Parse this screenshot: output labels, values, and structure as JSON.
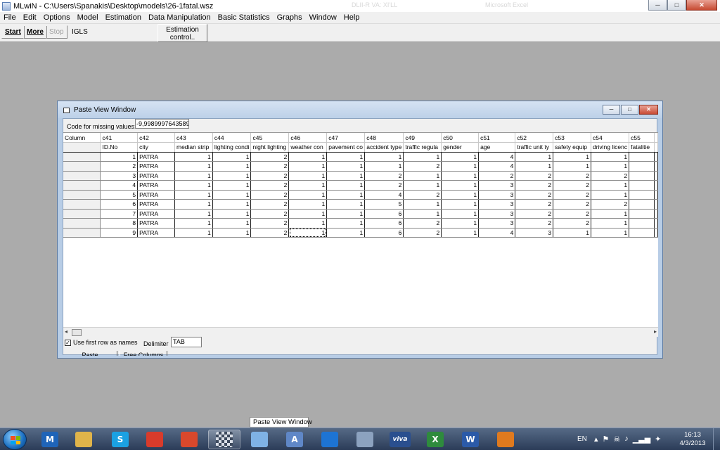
{
  "app": {
    "title": "MLwiN - C:\\Users\\Spanakis\\Desktop\\models\\26-1fatal.wsz",
    "ghost_title_1": "DLII-R VA: XI'LL",
    "ghost_title_2": "Microsoft Excel",
    "controls": {
      "minimize": "─",
      "maximize": "□",
      "close": "✕"
    }
  },
  "menu": [
    "File",
    "Edit",
    "Options",
    "Model",
    "Estimation",
    "Data Manipulation",
    "Basic Statistics",
    "Graphs",
    "Window",
    "Help"
  ],
  "toolbar": {
    "start": "Start",
    "more": "More",
    "stop": "Stop",
    "method": "IGLS",
    "estimation_control_line1": "Estimation",
    "estimation_control_line2": "control.."
  },
  "paste_view": {
    "title": "Paste View Window",
    "controls": {
      "minimize": "─",
      "maximize": "□",
      "close": "✕"
    },
    "missing_label": "Code for missing values:",
    "missing_value": "-9,9989997643589",
    "column_header": "Column",
    "columns": [
      "c41",
      "c42",
      "c43",
      "c44",
      "c45",
      "c46",
      "c47",
      "c48",
      "c49",
      "c50",
      "c51",
      "c52",
      "c53",
      "c54",
      "c55"
    ],
    "names": [
      "ID.No",
      "city",
      "median strip",
      "lighting condi",
      "night lighting",
      "weather con",
      "pavement co",
      "accident type",
      "traffic regula",
      "gender",
      "age",
      "traffic unit ty",
      "safety equip",
      "driving licenc",
      "fatalitie"
    ],
    "rows": [
      [
        "1",
        "PATRA",
        "1",
        "1",
        "2",
        "1",
        "1",
        "1",
        "1",
        "1",
        "4",
        "1",
        "1",
        "1",
        ""
      ],
      [
        "2",
        "PATRA",
        "1",
        "1",
        "2",
        "1",
        "1",
        "1",
        "2",
        "1",
        "4",
        "1",
        "1",
        "1",
        ""
      ],
      [
        "3",
        "PATRA",
        "1",
        "1",
        "2",
        "1",
        "1",
        "2",
        "1",
        "1",
        "2",
        "2",
        "2",
        "2",
        ""
      ],
      [
        "4",
        "PATRA",
        "1",
        "1",
        "2",
        "1",
        "1",
        "2",
        "1",
        "1",
        "3",
        "2",
        "2",
        "1",
        ""
      ],
      [
        "5",
        "PATRA",
        "1",
        "1",
        "2",
        "1",
        "1",
        "4",
        "2",
        "1",
        "3",
        "2",
        "2",
        "1",
        ""
      ],
      [
        "6",
        "PATRA",
        "1",
        "1",
        "2",
        "1",
        "1",
        "5",
        "1",
        "1",
        "3",
        "2",
        "2",
        "2",
        ""
      ],
      [
        "7",
        "PATRA",
        "1",
        "1",
        "2",
        "1",
        "1",
        "6",
        "1",
        "1",
        "3",
        "2",
        "2",
        "1",
        ""
      ],
      [
        "8",
        "PATRA",
        "1",
        "1",
        "2",
        "1",
        "1",
        "6",
        "2",
        "1",
        "3",
        "2",
        "2",
        "1",
        ""
      ],
      [
        "9",
        "PATRA",
        "1",
        "1",
        "2",
        "1",
        "1",
        "6",
        "2",
        "1",
        "4",
        "3",
        "1",
        "1",
        ""
      ]
    ],
    "use_first_row_label": "Use first row as names",
    "use_first_row_checked": true,
    "check_mark": "✓",
    "delimiter_label": "Delimiter",
    "delimiter_value": "TAB",
    "paste_button": "Paste",
    "free_columns_button": "Free Columns",
    "scroll_left": "◂",
    "scroll_right": "▸"
  },
  "tooltip": "Paste View Window",
  "taskbar": {
    "icons": [
      {
        "name": "maxthon-icon",
        "glyph": "M",
        "color": "#1f64b8"
      },
      {
        "name": "file-explorer-icon",
        "glyph": "",
        "color": "#e0b44a"
      },
      {
        "name": "skype-icon",
        "glyph": "S",
        "color": "#1ba1e2"
      },
      {
        "name": "chrome-icon",
        "glyph": "",
        "color": "#d93b2b"
      },
      {
        "name": "camera-app-icon",
        "glyph": "",
        "color": "#d9482c"
      },
      {
        "name": "mlwin-icon",
        "glyph": "",
        "color": "#9aa6b8"
      },
      {
        "name": "paint-icon",
        "glyph": "",
        "color": "#7fb2e5"
      },
      {
        "name": "word-doc-icon",
        "glyph": "A",
        "color": "#5f87c7"
      },
      {
        "name": "teamviewer-icon",
        "glyph": "",
        "color": "#1d74d4"
      },
      {
        "name": "calculator-icon",
        "glyph": "",
        "color": "#8ca2bf"
      },
      {
        "name": "viva-icon",
        "glyph": "viva",
        "color": "#2a4f8f"
      },
      {
        "name": "excel-icon",
        "glyph": "X",
        "color": "#2e8b3d"
      },
      {
        "name": "word-icon",
        "glyph": "W",
        "color": "#2b5aa8"
      },
      {
        "name": "matlab-icon",
        "glyph": "",
        "color": "#e07a1e"
      }
    ],
    "language": "EN",
    "tray_glyphs": [
      "▴",
      "⚑",
      "☠",
      "♪",
      "▁▃▅",
      "✦"
    ],
    "time": "16:13",
    "date": "4/3/2013"
  }
}
